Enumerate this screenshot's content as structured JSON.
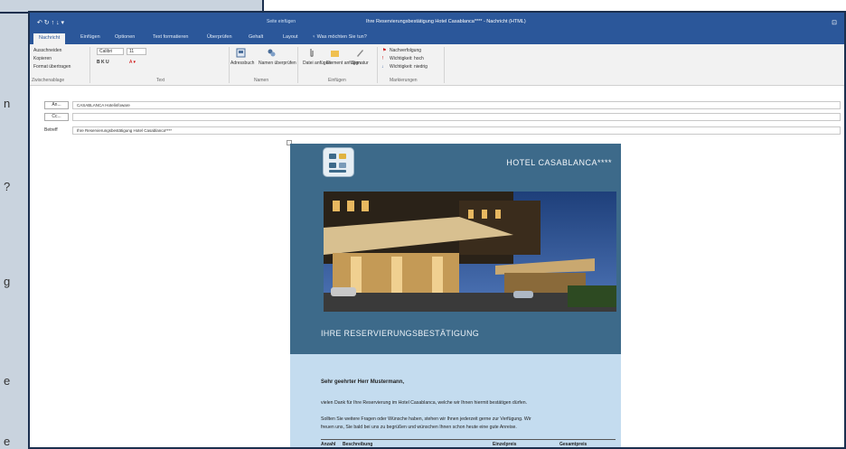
{
  "background_letters": [
    "n",
    "?",
    "g",
    "e",
    "e"
  ],
  "titlebar": {
    "controls": "↶ ↻ ↑ ↓ ▾",
    "context": "Seite einfügen",
    "title": "Ihre Reservierungsbestätigung Hotel Casablanca**** - Nachricht (HTML)",
    "window": "⊡"
  },
  "tabs": [
    "Nachricht",
    "Einfügen",
    "Optionen",
    "Text formatieren",
    "Überprüfen",
    "Gehalt",
    "Layout",
    "♀ Was möchten Sie tun?"
  ],
  "ribbon": {
    "clipboard": [
      "Ausschneiden",
      "Kopieren",
      "Format übertragen"
    ],
    "clipboard_group": "Zwischenablage",
    "font": "Calibri",
    "size": "11",
    "font_buttons": "B  K  U",
    "text_group": "Text",
    "names": [
      "Adressbuch",
      "Namen überprüfen"
    ],
    "names_group": "Namen",
    "include": [
      "Datei anfügen",
      "Element anfügen",
      "Signatur"
    ],
    "include_group": "Einfügen",
    "tags": [
      "Nachverfolgung",
      "Wichtigkeit: hoch",
      "Wichtigkeit: niedrig"
    ],
    "tags_group": "Markierungen"
  },
  "fields": {
    "to_label": "An...",
    "to_value": "CASABLANCA Hotelinfoware",
    "cc_label": "Cc...",
    "cc_value": "",
    "subject_label": "Betreff",
    "subject_value": "Ihre Reservierungsbestätigung Hotel Casablanca****"
  },
  "email": {
    "hotel_name": "HOTEL CASABLANCA****",
    "section_title": "IHRE RESERVIERUNGSBESTÄTIGUNG",
    "greeting": "Sehr geehrter Herr Mustermann,",
    "p1": "vielen Dank für Ihre Reservierung im Hotel Casablanca, welche wir Ihnen hiermit bestätigen dürfen.",
    "p2a": "Sollten Sie weitere Fragen oder Wünsche haben, stehen wir Ihnen jederzeit gerne zur Verfügung. Wir",
    "p2b": "freuen uns, Sie bald bei uns zu begrüßen und wünschen Ihnen schon heute eine gute Anreise.",
    "table_headers": [
      "Anzahl",
      "Beschreibung",
      "Einzelpreis",
      "Gesamtpreis"
    ]
  },
  "colors": {
    "accent": "#2b579a",
    "email_header": "#3d6a8a",
    "email_body": "#c4dcef"
  }
}
